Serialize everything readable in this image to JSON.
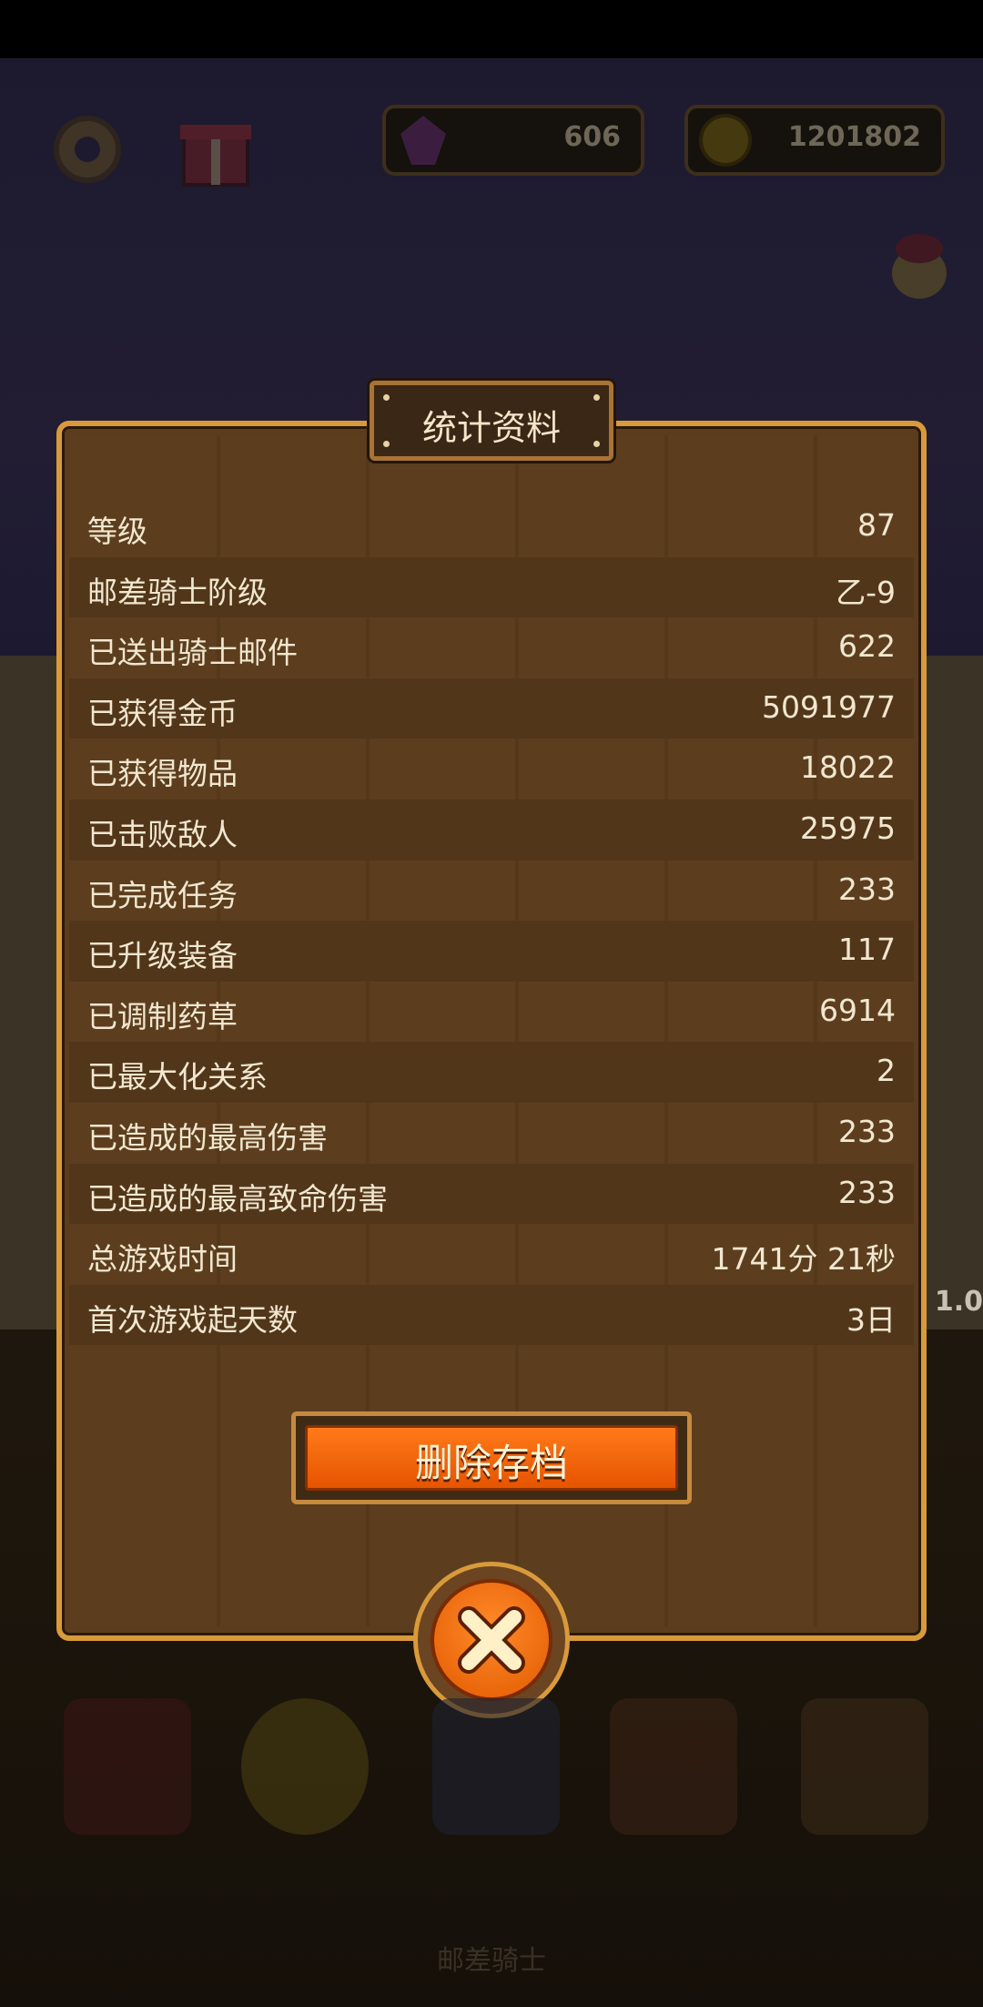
{
  "hud": {
    "gems": "606",
    "coins": "1201802",
    "icons": [
      "gear-icon",
      "gift-icon",
      "gem-icon",
      "coin-icon"
    ]
  },
  "side_text": "1.0",
  "modal": {
    "title": "统计资料",
    "stats": [
      {
        "label": "等级",
        "value": "87"
      },
      {
        "label": "邮差骑士阶级",
        "value": "乙-9"
      },
      {
        "label": "已送出骑士邮件",
        "value": "622"
      },
      {
        "label": "已获得金币",
        "value": "5091977"
      },
      {
        "label": "已获得物品",
        "value": "18022"
      },
      {
        "label": "已击败敌人",
        "value": "25975"
      },
      {
        "label": "已完成任务",
        "value": "233"
      },
      {
        "label": "已升级装备",
        "value": "117"
      },
      {
        "label": "已调制药草",
        "value": "6914"
      },
      {
        "label": "已最大化关系",
        "value": "2"
      },
      {
        "label": "已造成的最高伤害",
        "value": "233"
      },
      {
        "label": "已造成的最高致命伤害",
        "value": "233"
      },
      {
        "label": "总游戏时间",
        "value": "1741分 21秒"
      },
      {
        "label": "首次游戏起天数",
        "value": "3日"
      }
    ],
    "delete_label": "删除存档"
  },
  "bottom_nav": {
    "label": "邮差骑士",
    "icons": [
      "book-icon",
      "star-coin-icon",
      "card-icon",
      "inventory-bag-icon",
      "loot-sack-icon"
    ]
  },
  "colors": {
    "accent": "#e65400",
    "frame": "#d89a3a",
    "panel": "#5b3d1d"
  }
}
